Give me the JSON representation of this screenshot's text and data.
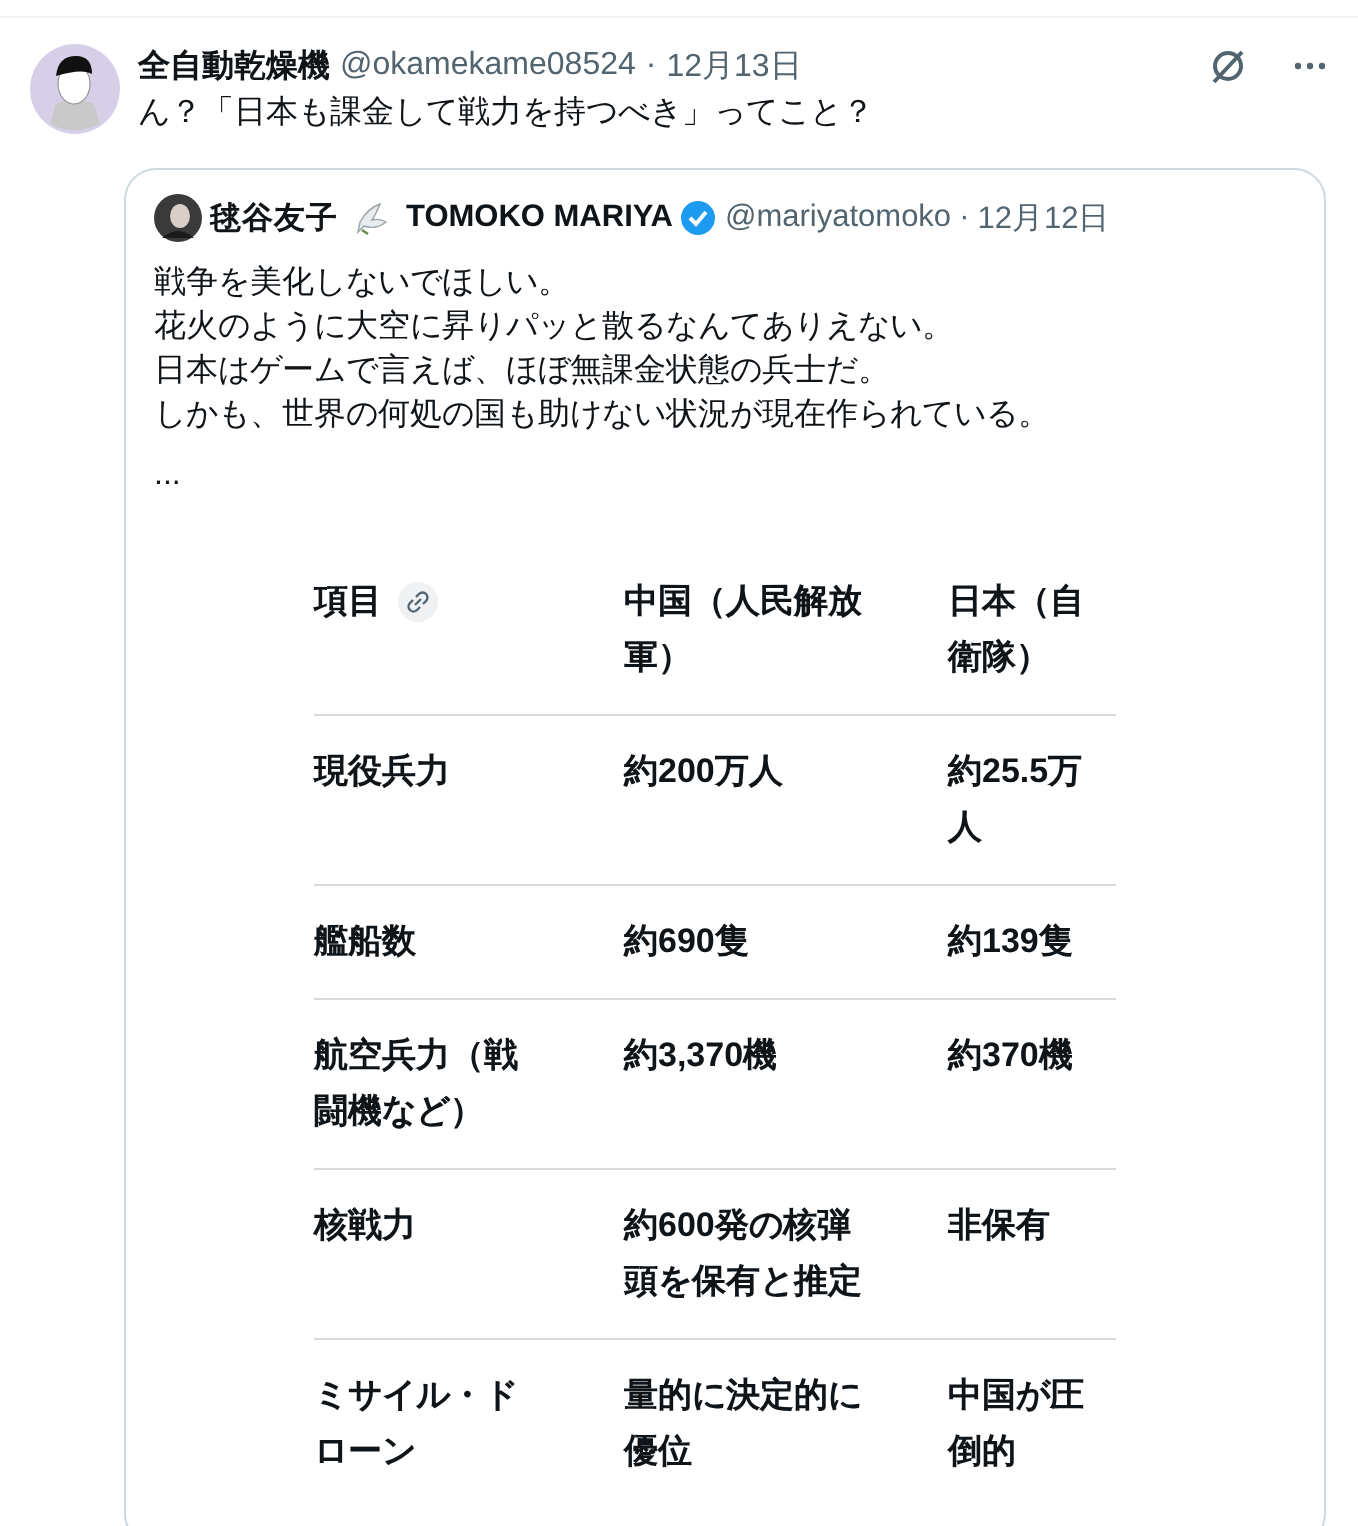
{
  "post": {
    "display_name": "全自動乾燥機",
    "handle": "@okamekame08524",
    "separator": "·",
    "date": "12月13日",
    "text": "ん？「日本も課金して戦力を持つべき」ってこと？"
  },
  "quote": {
    "name": "毬谷友子",
    "name_latin": "TOMOKO MARIYA",
    "verified": true,
    "handle": "@mariyatomoko",
    "separator": "·",
    "date": "12月12日",
    "lines": [
      "戦争を美化しないでほしい。",
      "花火のように大空に昇りパッと散るなんてありえない。",
      "日本はゲームで言えば、ほぼ無課金状態の兵士だ。",
      "しかも、世界の何処の国も助けない状況が現在作られている。",
      "..."
    ],
    "table": {
      "columns": [
        "項目",
        "中国（人民解放軍）",
        "日本（自衛隊）"
      ],
      "rows": [
        [
          "現役兵力",
          "約200万人",
          "約25.5万人"
        ],
        [
          "艦船数",
          "約690隻",
          "約139隻"
        ],
        [
          "航空兵力（戦闘機など）",
          "約3,370機",
          "約370機"
        ],
        [
          "核戦力",
          "約600発の核弾頭を保有と推定",
          "非保有"
        ],
        [
          "ミサイル・ドローン",
          "量的に決定的に優位",
          "中国が圧倒的"
        ]
      ]
    }
  }
}
